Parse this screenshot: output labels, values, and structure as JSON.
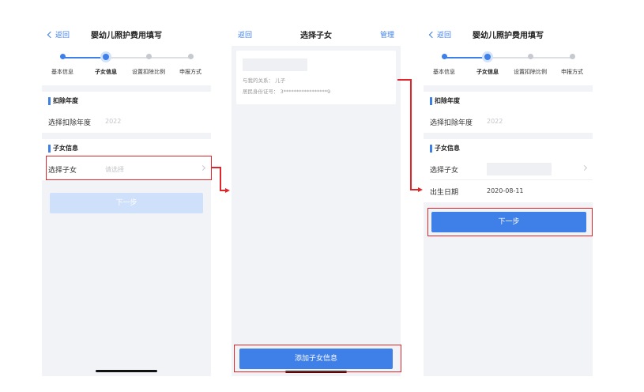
{
  "screens": [
    {
      "nav": {
        "back": "返回",
        "title": "婴幼儿照护费用填写"
      },
      "steps": [
        "基本信息",
        "子女信息",
        "设置扣除比例",
        "申报方式"
      ],
      "current_step": 2,
      "deduction_section": {
        "title": "扣除年度",
        "label": "选择扣除年度",
        "value": "2022"
      },
      "child_section": {
        "title": "子女信息",
        "label": "选择子女",
        "placeholder": "请选择"
      },
      "next_button": "下一步"
    },
    {
      "nav": {
        "back": "返回",
        "title": "选择子女",
        "manage": "管理"
      },
      "child_card": {
        "relation": "与我的关系：  儿子",
        "id": "居民身份证号：  3*****************9"
      },
      "add_button": "添加子女信息"
    },
    {
      "nav": {
        "back": "返回",
        "title": "婴幼儿照护费用填写"
      },
      "steps": [
        "基本信息",
        "子女信息",
        "设置扣除比例",
        "申报方式"
      ],
      "current_step": 2,
      "deduction_section": {
        "title": "扣除年度",
        "label": "选择扣除年度",
        "value": "2022"
      },
      "child_section": {
        "title": "子女信息",
        "label": "选择子女",
        "birth_label": "出生日期",
        "birth_value": "2020-08-11"
      },
      "next_button": "下一步"
    }
  ],
  "colors": {
    "accent": "#3f7fe8",
    "highlight": "#e1262b",
    "disabled": "#cfe1fa",
    "background": "#f2f3f6"
  },
  "icons": [
    "chevron-left-icon",
    "chevron-right-icon",
    "arrow-right-icon"
  ]
}
